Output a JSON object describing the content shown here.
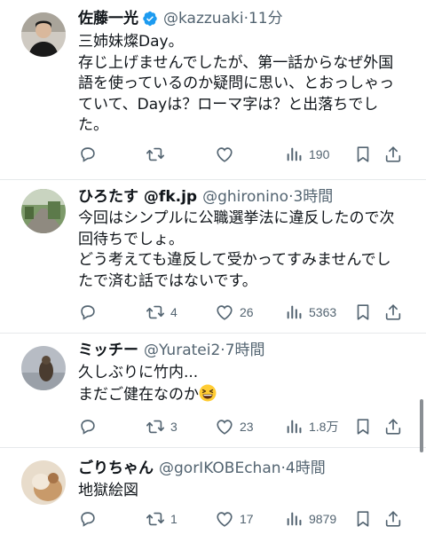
{
  "tweets": [
    {
      "name": "佐藤一光",
      "verified": true,
      "handle": "@kazzuaki",
      "time": "11分",
      "text": "三姉妹燦Day。\n存じ上げませんでしたが、第一話からなぜ外国\n語を使っているのか疑問に思い、とおっしゃっ\nていて、Dayは？ローマ字は？と出落ちでし\nた。",
      "replies": "",
      "retweets": "",
      "likes": "",
      "views": "190"
    },
    {
      "name": "ひろたす @fk.jp",
      "verified": false,
      "handle": "@ghironino",
      "time": "3時間",
      "text": "今回はシンプルに公職選挙法に違反したので次\n回待ちでしょ。\nどう考えても違反して受かってすみませんでし\nたで済む話ではないです。",
      "replies": "",
      "retweets": "4",
      "likes": "26",
      "views": "5363"
    },
    {
      "name": "ミッチー",
      "verified": false,
      "handle": "@Yuratei2",
      "time": "7時間",
      "text": "久しぶりに竹内...\nまだご健在なのか",
      "emoji": "grinning-squinting-face",
      "replies": "",
      "retweets": "3",
      "likes": "23",
      "views": "1.8万"
    },
    {
      "name": "ごりちゃん",
      "verified": false,
      "handle": "@gorIKOBEchan",
      "time": "4時間",
      "text": "地獄絵図",
      "replies": "",
      "retweets": "1",
      "likes": "17",
      "views": "9879"
    }
  ],
  "icons": [
    "reply-icon",
    "retweet-icon",
    "like-icon",
    "views-icon",
    "bookmark-icon",
    "share-icon",
    "verified-badge-icon"
  ],
  "colors": {
    "text": "#0f1419",
    "secondary": "#536471",
    "verified": "#1d9bf0",
    "divider": "#e6e9eb"
  }
}
